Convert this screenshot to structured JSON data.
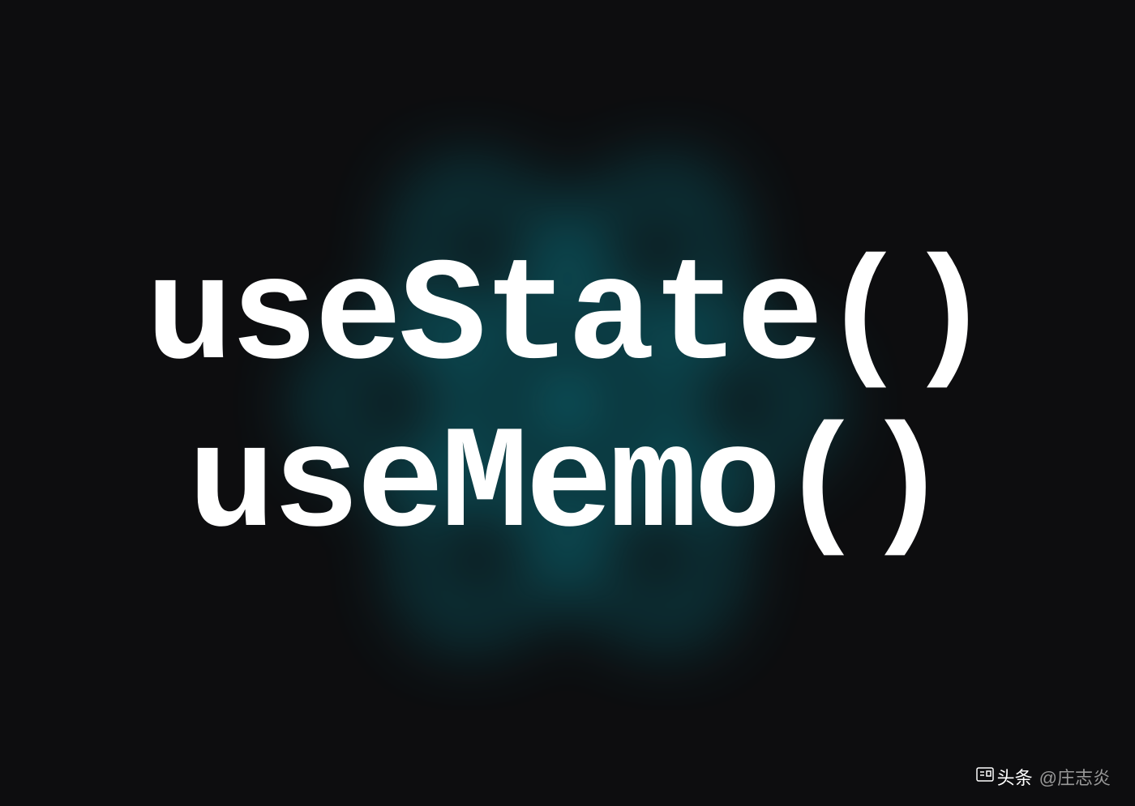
{
  "hooks": {
    "line1": "useState()",
    "line2": "useMemo()"
  },
  "watermark": {
    "logo_text": "头条",
    "author": "@庄志炎"
  },
  "colors": {
    "background": "#0d0d0f",
    "text": "#ffffff",
    "react_glow": "#0a8a9a",
    "watermark_author": "#999999"
  }
}
